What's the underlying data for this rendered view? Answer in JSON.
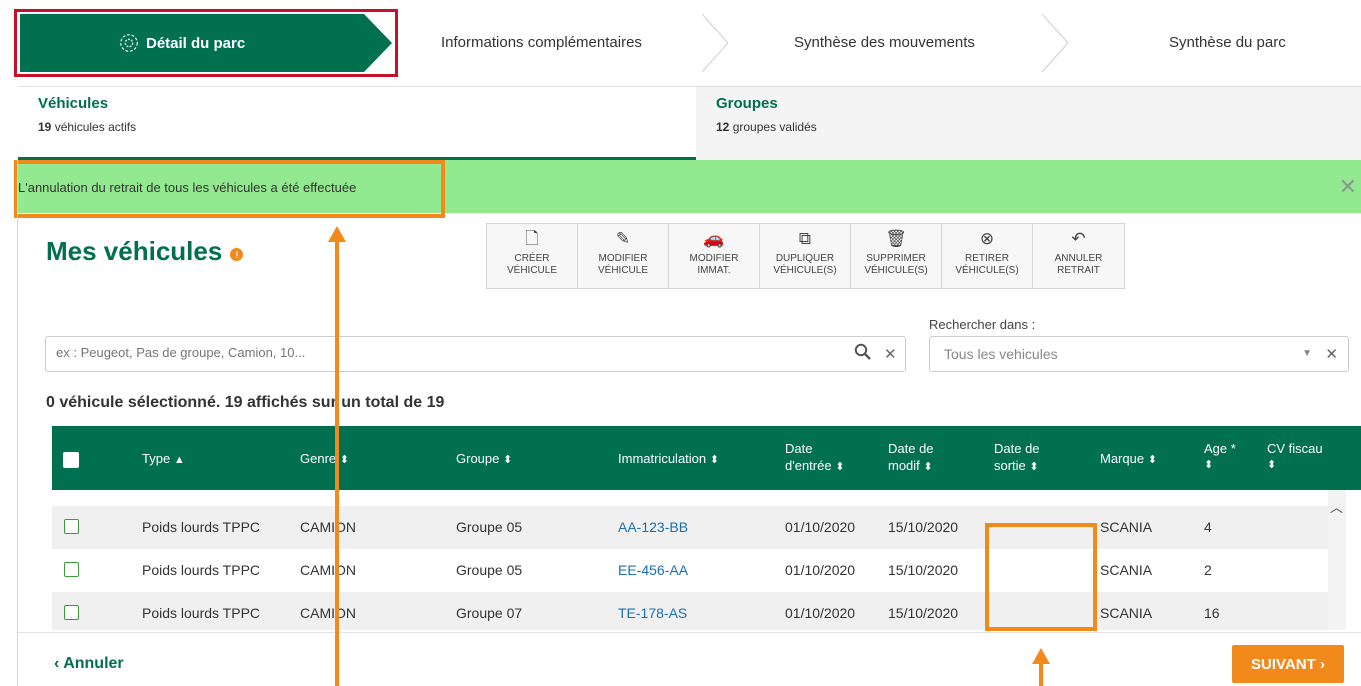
{
  "stepper": {
    "active_label": "Détail du parc",
    "steps": [
      "Informations complémentaires",
      "Synthèse des mouvements",
      "Synthèse du parc"
    ]
  },
  "tabs": [
    {
      "title": "Véhicules",
      "count": "19",
      "sub": "véhicules actifs"
    },
    {
      "title": "Groupes",
      "count": "12",
      "sub": "groupes validés"
    }
  ],
  "banner": {
    "message": "L'annulation du retrait de tous les véhicules a été effectuée",
    "close": "✕"
  },
  "page": {
    "title": "Mes véhicules",
    "info": "!"
  },
  "toolbar": [
    {
      "icon": "create-doc-icon",
      "glyph": "🗋",
      "line1": "CRÉER",
      "line2": "VÉHICULE"
    },
    {
      "icon": "pencil-icon",
      "glyph": "✎",
      "line1": "MODIFIER",
      "line2": "VÉHICULE"
    },
    {
      "icon": "plate-car-icon",
      "glyph": "🚗",
      "line1": "MODIFIER",
      "line2": "IMMAT."
    },
    {
      "icon": "duplicate-icon",
      "glyph": "⧉",
      "line1": "DUPLIQUER",
      "line2": "VÉHICULE(S)"
    },
    {
      "icon": "trash-icon",
      "glyph": "🗑",
      "line1": "SUPPRIMER",
      "line2": "VÉHICULE(S)"
    },
    {
      "icon": "car-remove-icon",
      "glyph": "⊗",
      "line1": "RETIRER",
      "line2": "VÉHICULE(S)"
    },
    {
      "icon": "undo-circle-icon",
      "glyph": "↶",
      "line1": "ANNULER",
      "line2": "RETRAIT"
    }
  ],
  "search": {
    "placeholder": "ex : Peugeot, Pas de groupe, Camion, 10...",
    "scope_label": "Rechercher dans :",
    "scope_value": "Tous les vehicules"
  },
  "count_line": "0 véhicule sélectionné. 19 affichés sur un total de 19",
  "table": {
    "headers": {
      "type": "Type",
      "genre": "Genre",
      "groupe": "Groupe",
      "immat": "Immatriculation",
      "date_entree_1": "Date",
      "date_entree_2": "d'entrée",
      "date_modif_1": "Date de",
      "date_modif_2": "modif",
      "date_sortie_1": "Date de",
      "date_sortie_2": "sortie",
      "marque": "Marque",
      "age": "Age *",
      "cv": "CV fiscau"
    },
    "rows": [
      {
        "type": "Poids lourds TPPC",
        "genre": "CAMION",
        "groupe": "Groupe 05",
        "immat": "AA-123-BB",
        "entree": "01/10/2020",
        "modif": "15/10/2020",
        "sortie": "",
        "marque": "SCANIA",
        "age": "4"
      },
      {
        "type": "Poids lourds TPPC",
        "genre": "CAMION",
        "groupe": "Groupe 05",
        "immat": "EE-456-AA",
        "entree": "01/10/2020",
        "modif": "15/10/2020",
        "sortie": "",
        "marque": "SCANIA",
        "age": "2"
      },
      {
        "type": "Poids lourds TPPC",
        "genre": "CAMION",
        "groupe": "Groupe 07",
        "immat": "TE-178-AS",
        "entree": "01/10/2020",
        "modif": "15/10/2020",
        "sortie": "",
        "marque": "SCANIA",
        "age": "16"
      }
    ]
  },
  "footer": {
    "cancel": "Annuler",
    "next": "SUIVANT"
  },
  "colors": {
    "brand_green": "#00704f",
    "orange": "#f28a1b",
    "banner_green": "#92e98f",
    "highlight_red": "#c5102a"
  }
}
